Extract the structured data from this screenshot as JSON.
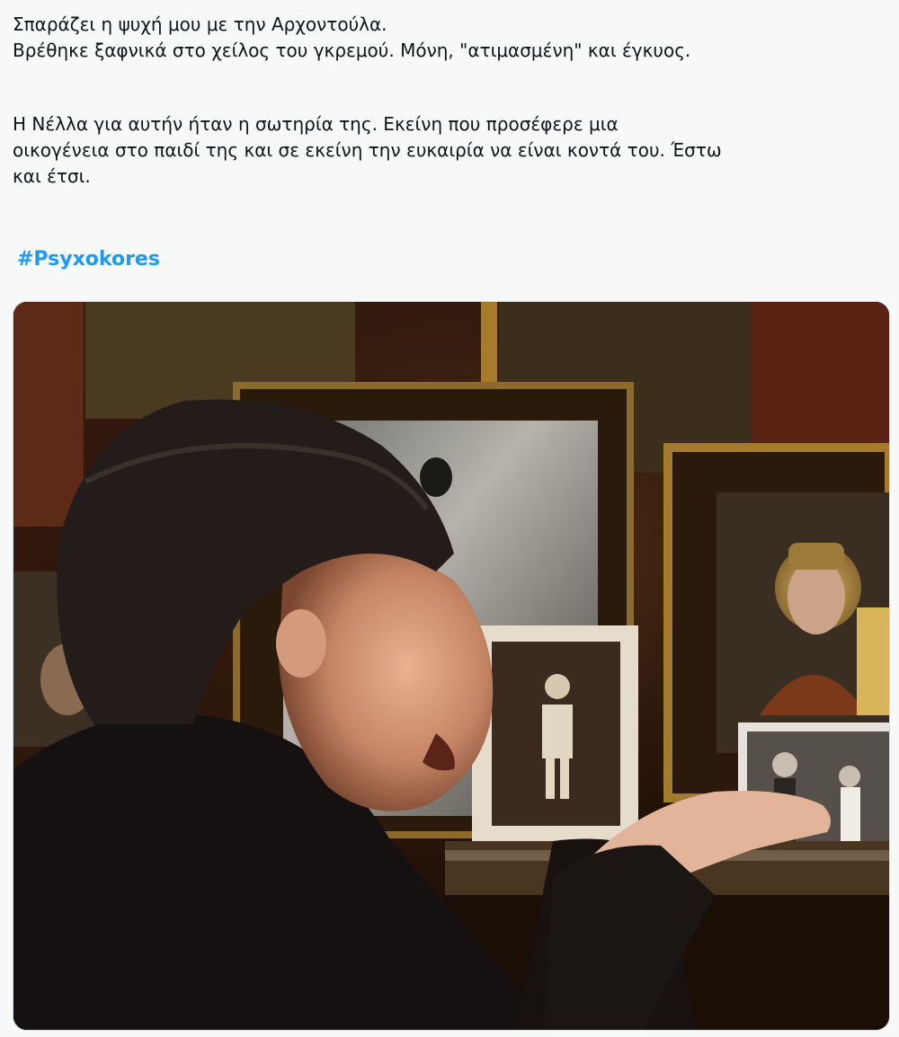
{
  "tweet": {
    "cut_line": "",
    "paragraph1": [
      "Σπαράζει η ψυχή μου με την Αρχοντούλα.",
      "Βρέθηκε ξαφνικά στο χείλος του γκρεμού. Μόνη, \"ατιμασμένη\" και έγκυος."
    ],
    "paragraph2": [
      "Η Νέλλα για αυτήν ήταν η σωτηρία της. Εκείνη που προσέφερε μια",
      "οικογένεια στο παιδί της και σε εκείνη την ευκαιρία να είναι κοντά του. Έστω",
      "και έτσι."
    ],
    "hashtag": "#Psyxokores"
  },
  "colors": {
    "text": "#0f1419",
    "link": "#1d9bf0",
    "background": "#f7f9f9"
  },
  "media": {
    "icon": "photo"
  }
}
